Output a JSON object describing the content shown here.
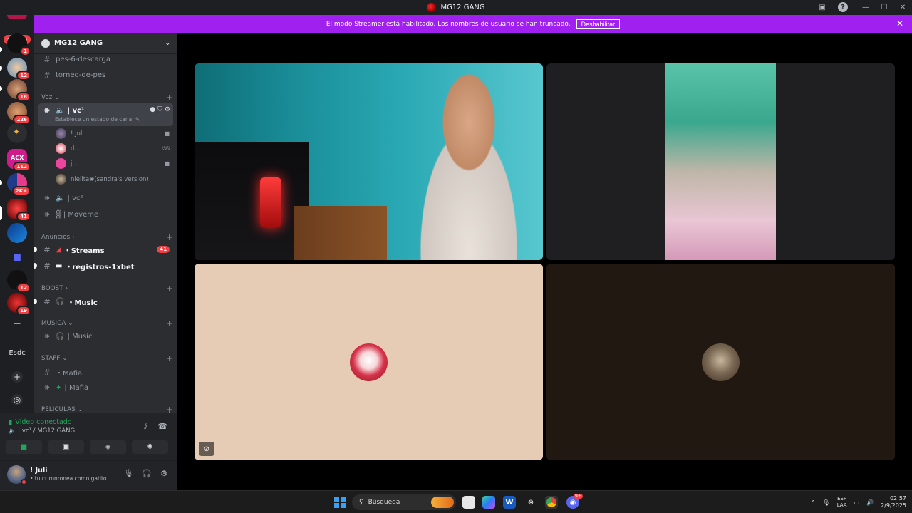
{
  "window": {
    "title": "MG12 GANG"
  },
  "banner": {
    "text": "El modo Streamer está habilitado. Los nombres de usuario se han truncado.",
    "button": "Deshabilitar"
  },
  "guilds": {
    "nuevo": "NUEVO",
    "badges": [
      "1",
      "12",
      "18",
      "226",
      "112",
      "2K+",
      "41",
      "12",
      "19"
    ],
    "text_item": "Esdc",
    "dash": "—"
  },
  "server": {
    "name": "MG12 GANG"
  },
  "channels": {
    "top": [
      "pes-6-descarga",
      "torneo-de-pes"
    ],
    "voz_label": "Voz",
    "vc1": {
      "name": "| vc¹",
      "status": "Establece un estado de canal"
    },
    "members": [
      {
        "name": "!.Juli"
      },
      {
        "name": "d..."
      },
      {
        "name": "j..."
      },
      {
        "name": "nielita❀(sandra's version)"
      }
    ],
    "vc2": "| vc²",
    "moveme": "▒ | Moveme",
    "anuncios_label": "Anuncios",
    "streams": "・Streams",
    "streams_mentions": "41",
    "registros": "・registros-1xbet",
    "boost_label": "BOOST",
    "music1": "・Music",
    "musica_label": "MUSICA",
    "music2": "| Music",
    "staff_label": "STAFF",
    "mafia1": "・Mafia",
    "mafia2": "| Mafia",
    "peliculas_label": "PELICULAS"
  },
  "voice_panel": {
    "title": "Vídeo conectado",
    "subtitle": "| vc¹ / MG12 GANG"
  },
  "user": {
    "name": "! Juli",
    "status": "• tu cr ronronea como gatito"
  },
  "taskbar": {
    "search": "Búsqueda",
    "lang_top": "ESP",
    "lang_bottom": "LAA",
    "time": "02:57",
    "date": "2/9/2025",
    "discord_badge": "9+"
  },
  "colors": {
    "banner": "#a020f0",
    "mention": "#f23f43",
    "connected": "#23a55a"
  }
}
